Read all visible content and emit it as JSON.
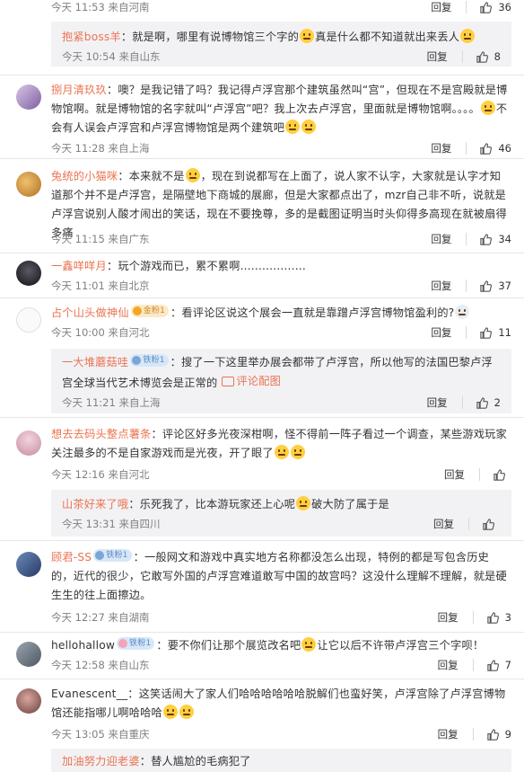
{
  "ui": {
    "reply": "回复",
    "view_comment_image": "评论配图"
  },
  "comments": [
    {
      "meta": "今天 11:53 来自河南",
      "likes": "36"
    },
    {
      "user": "抱紧boss羊",
      "text1": "：就是啊，哪里有说博物馆三个字的",
      "text2": "真是什么都不知道就出来丢人",
      "meta": "今天 10:54 来自山东",
      "likes": "8"
    },
    {
      "user": "捌月清玖玖",
      "text1": "：噢？是我记错了吗？我记得卢浮宫那个建筑虽然叫“宫”，但现在不是宫殿就是博物馆啊。就是博物馆的名字就叫“卢浮宫”吧？我上次去卢浮宫，里面就是博物馆啊。。。。",
      "text2": "不会有人误会卢浮宫和卢浮宫博物馆是两个建筑吧",
      "meta": "今天 11:28 来自上海",
      "likes": "46"
    },
    {
      "user": "兔统的小猫咪",
      "text1": "：本来就不是",
      "text2": "，现在到说都写在上面了，说人家不认字，大家就是认字才知道那个并不是卢浮宫，是隔壁地下商城的展廊，但是大家都点出了，mzr自己非不听，说就是卢浮宫说别人酸才闹出的笑话，现在不要挽尊，多的是截图证明当时头仰得多高现在就被扇得多痛",
      "meta": "今天 11:15 来自广东",
      "likes": "34"
    },
    {
      "user": "一鑫咩咩月",
      "text1": "：玩个游戏而已，累不累啊..................",
      "meta": "今天 11:01 来自北京",
      "likes": "37"
    },
    {
      "user": "占个山头做神仙",
      "badge": "金粉1",
      "text1": "：看评论区说这个展会一直就是靠蹭卢浮宫博物馆盈利的?",
      "meta": "今天 10:00 来自河北",
      "likes": "11"
    },
    {
      "user": "一大堆蘑菇哇",
      "badge": "铁粉1",
      "text1": "：搜了一下这里举办展会都带了卢浮宫，所以他写的法国巴黎卢浮宫全球当代艺术博览会是正常的",
      "meta": "今天 11:21 来自上海",
      "likes": "2"
    },
    {
      "user": "想去去码头整点薯条",
      "text1": "：评论区好多光夜深柑啊，怪不得前一阵子看过一个调查，某些游戏玩家关注最多的不是自家游戏而是光夜，开了眼了",
      "meta": "今天 12:16 来自河北",
      "likes": ""
    },
    {
      "user": "山茶好来了哦",
      "text1": "：乐死我了，比本游玩家还上心呢",
      "text2": "破大防了属于是",
      "meta": "今天 13:31 来自四川",
      "likes": ""
    },
    {
      "user": "顾君-SS",
      "badge": "铁粉1",
      "text1": "：一般网文和游戏中真实地方名称都没怎么出现，特例的都是写包含历史的，近代的很少，它敢写外国的卢浮宫难道敢写中国的故宫吗？这没什么理解不理解，就是硬生生的往上面擦边。",
      "meta": "今天 12:27 来自湖南",
      "likes": "3"
    },
    {
      "user": "hellohallow",
      "badge": "铁粉1",
      "text1": "：要不你们让那个展览改名吧",
      "text2": "让它以后不许带卢浮宫三个字呗！",
      "meta": "今天 12:58 来自山东",
      "likes": "7"
    },
    {
      "user": "Evanescent__",
      "text1": "：这笑话闹大了家人们哈哈哈哈哈哈脱解们也蛮好笑，卢浮宫除了卢浮宫博物馆还能指哪儿啊哈哈哈",
      "meta": "今天 13:05 来自重庆",
      "likes": "9"
    },
    {
      "user": "加油努力迎老婆",
      "text1": "：替人尴尬的毛病犯了"
    }
  ],
  "colors": {
    "username": "#eb7350",
    "meta": "#808080",
    "subBg": "#f2f2f5",
    "divider": "#e6e6e6"
  }
}
